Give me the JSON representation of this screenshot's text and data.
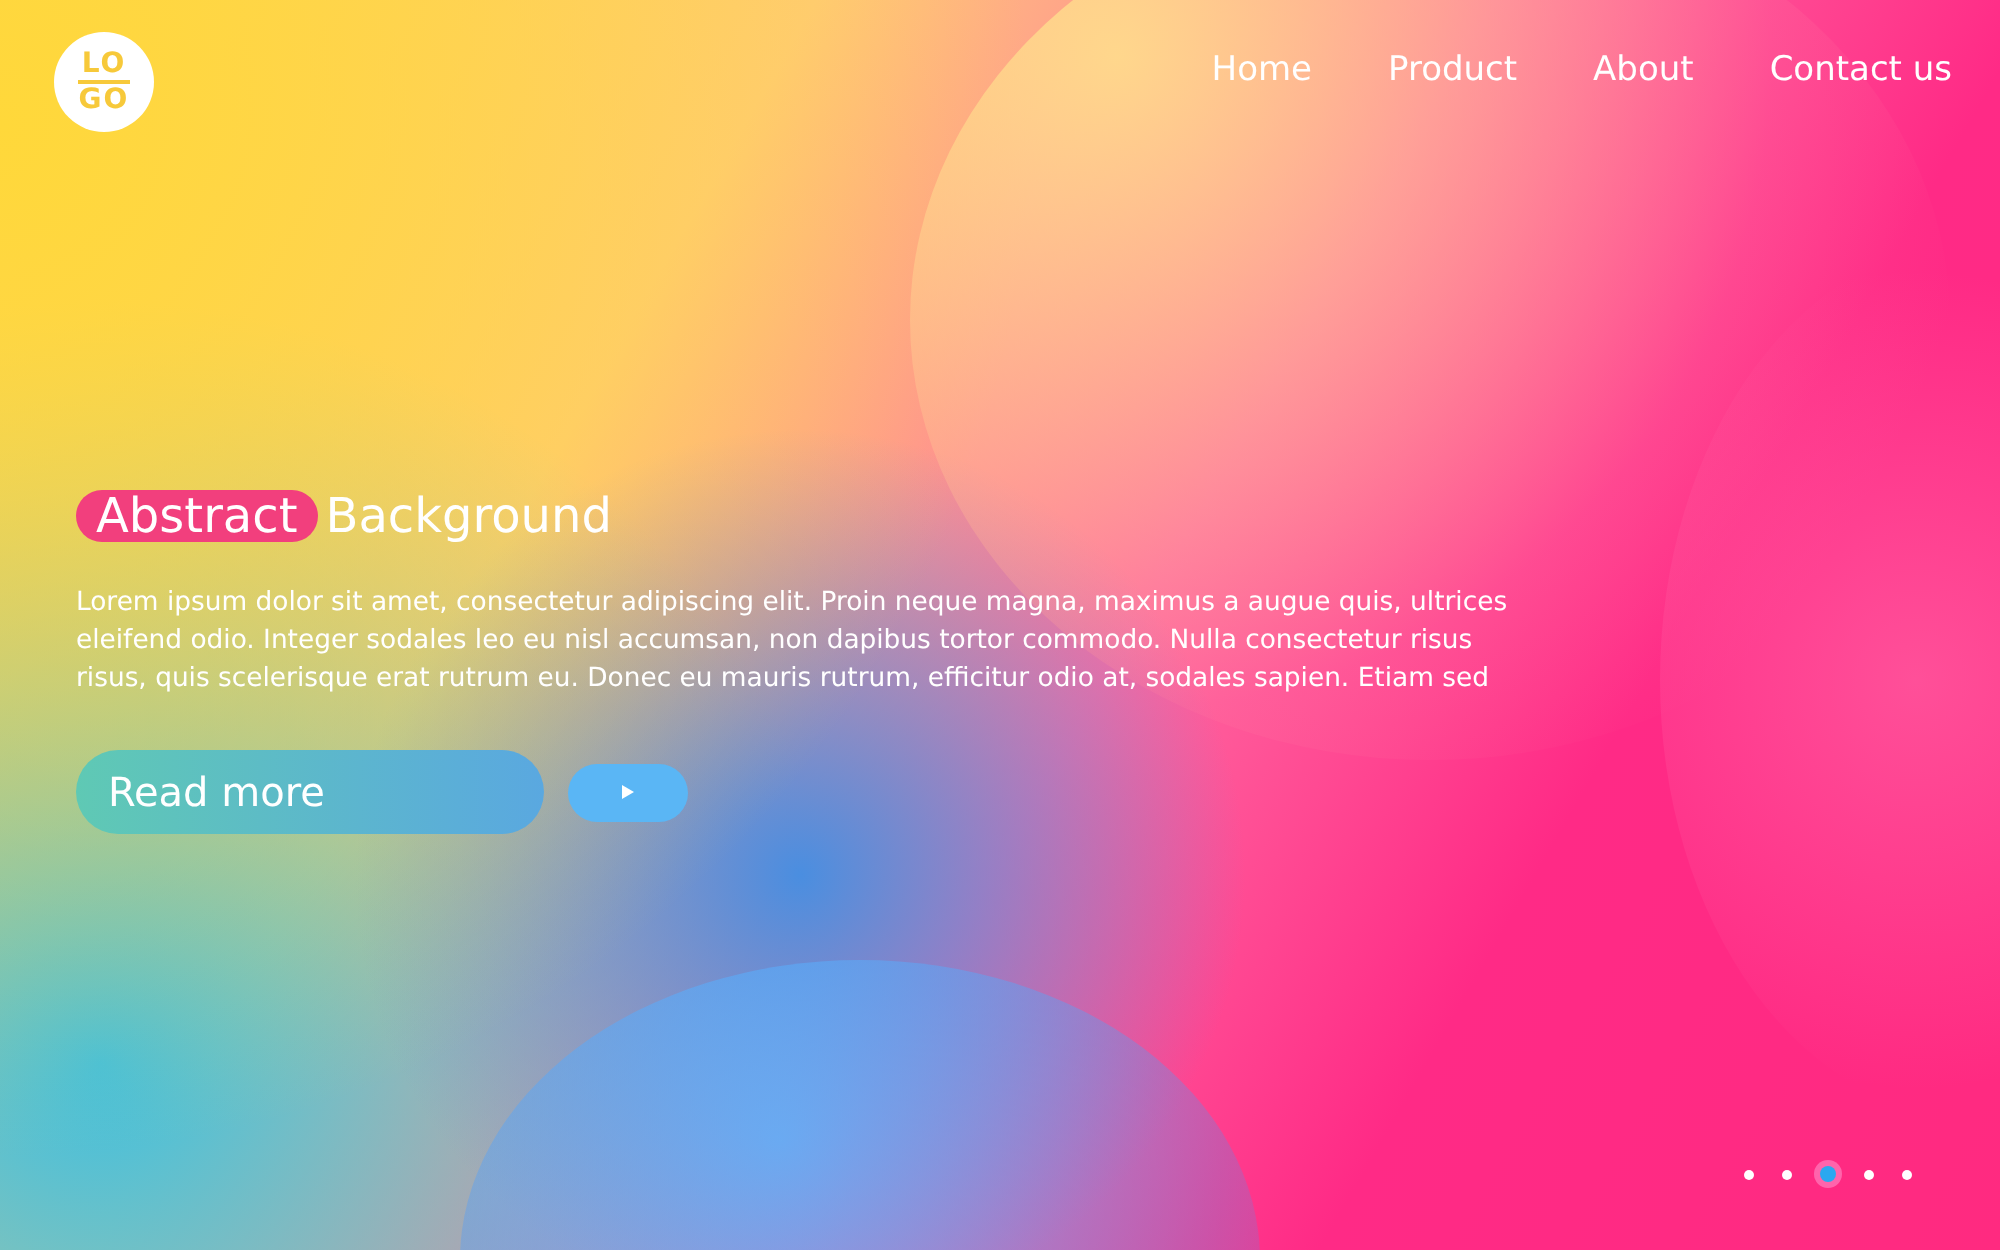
{
  "logo": {
    "top": "LO",
    "bottom": "GO"
  },
  "nav": [
    {
      "label": "Home"
    },
    {
      "label": "Product"
    },
    {
      "label": "About"
    },
    {
      "label": "Contact us"
    }
  ],
  "hero": {
    "highlight": "Abstract",
    "title": "Background",
    "body": "Lorem ipsum dolor sit amet, consectetur adipiscing elit. Proin neque magna, maximus a augue quis, ultrices eleifend odio. Integer sodales leo eu nisl accumsan, non dapibus tortor commodo. Nulla consectetur risus risus, quis scelerisque erat rutrum eu. Donec eu mauris rutrum, efficitur odio at, sodales sapien. Etiam sed",
    "button": "Read more"
  },
  "pager": [
    {
      "selected": false
    },
    {
      "selected": false
    },
    {
      "selected": true
    },
    {
      "selected": false
    },
    {
      "selected": false
    }
  ]
}
